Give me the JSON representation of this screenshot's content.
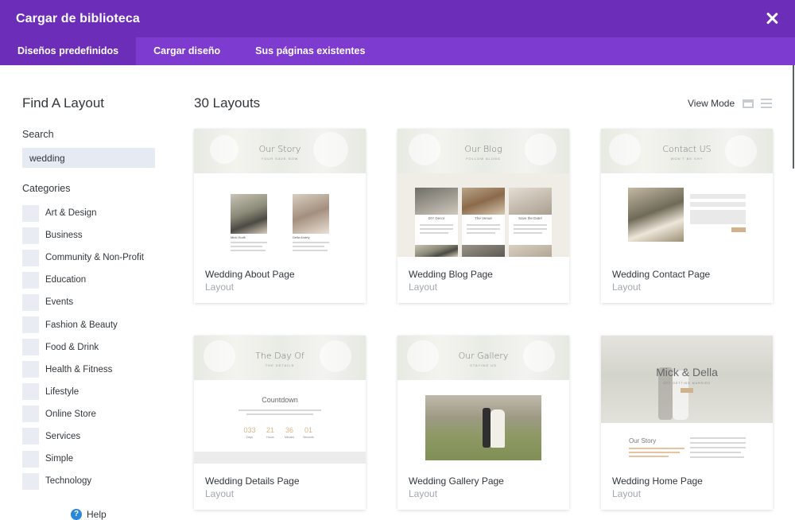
{
  "header": {
    "title": "Cargar de biblioteca",
    "close_icon": "close-icon"
  },
  "tabs": [
    {
      "label": "Diseños predefinidos",
      "active": true
    },
    {
      "label": "Cargar diseño",
      "active": false
    },
    {
      "label": "Sus páginas existentes",
      "active": false
    }
  ],
  "sidebar": {
    "title": "Find A Layout",
    "search_label": "Search",
    "search_value": "wedding",
    "categories_label": "Categories",
    "categories": [
      "Art & Design",
      "Business",
      "Community & Non-Profit",
      "Education",
      "Events",
      "Fashion & Beauty",
      "Food & Drink",
      "Health & Fitness",
      "Lifestyle",
      "Online Store",
      "Services",
      "Simple",
      "Technology"
    ],
    "help_label": "Help"
  },
  "main": {
    "count_title": "30 Layouts",
    "view_mode_label": "View Mode"
  },
  "cards": [
    {
      "name": "Wedding About Page",
      "type": "Layout",
      "thumb_title": "Our Story",
      "thumb_sub": "YOUR SAVE NOW",
      "people": [
        "Mick Hudlt",
        "Della Andrty"
      ]
    },
    {
      "name": "Wedding Blog Page",
      "type": "Layout",
      "thumb_title": "Our Blog",
      "thumb_sub": "FOLLOW ALONG",
      "posts": [
        "DIY Decor",
        "The Venue",
        "Save the Date!"
      ]
    },
    {
      "name": "Wedding Contact Page",
      "type": "Layout",
      "thumb_title": "Contact US",
      "thumb_sub": "WON'T BE SHY"
    },
    {
      "name": "Wedding Details Page",
      "type": "Layout",
      "thumb_title": "The Day Of",
      "thumb_sub": "THE DETAILS",
      "countdown_title": "Countdown",
      "countdown": [
        {
          "value": "033",
          "unit": "Days"
        },
        {
          "value": "21",
          "unit": "Hours"
        },
        {
          "value": "36",
          "unit": "Minutes"
        },
        {
          "value": "01",
          "unit": "Seconds"
        }
      ]
    },
    {
      "name": "Wedding Gallery Page",
      "type": "Layout",
      "thumb_title": "Our Gallery",
      "thumb_sub": "STAYING US"
    },
    {
      "name": "Wedding Home Page",
      "type": "Layout",
      "thumb_title": "Mick & Della",
      "thumb_sub": "ARE GETTING MARRIED",
      "section_title": "Our Story"
    }
  ],
  "colors": {
    "header": "#6c2eb9",
    "tabs": "#7d3bcf",
    "accent_gold": "#d0b38c",
    "help_blue": "#2b87da"
  }
}
